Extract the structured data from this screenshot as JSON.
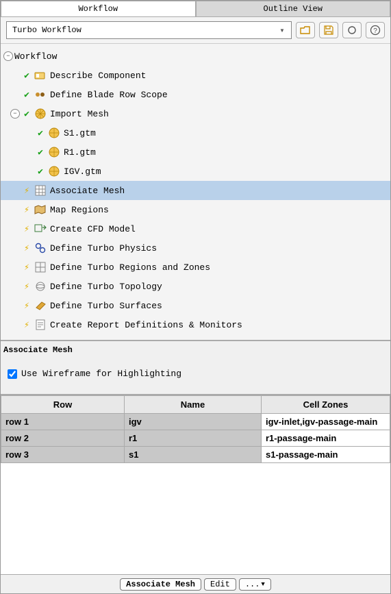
{
  "tabs": {
    "workflow": "Workflow",
    "outline": "Outline View"
  },
  "combo": {
    "value": "Turbo Workflow"
  },
  "tree": {
    "root": "Workflow",
    "items": {
      "describe": "Describe Component",
      "scope": "Define Blade Row Scope",
      "import": "Import Mesh",
      "mesh1": "S1.gtm",
      "mesh2": "R1.gtm",
      "mesh3": "IGV.gtm",
      "assoc": "Associate Mesh",
      "map": "Map Regions",
      "cfd": "Create CFD Model",
      "physics": "Define Turbo Physics",
      "regions": "Define Turbo Regions and Zones",
      "topology": "Define Turbo Topology",
      "surfaces": "Define Turbo Surfaces",
      "report": "Create Report Definitions & Monitors"
    }
  },
  "panel": {
    "title": "Associate Mesh",
    "checkbox_label": "Use Wireframe for Highlighting",
    "checkbox_checked": true
  },
  "table": {
    "headers": {
      "row": "Row",
      "name": "Name",
      "zones": "Cell Zones"
    },
    "rows": [
      {
        "row": "row 1",
        "name": "igv",
        "zones": "igv-inlet,igv-passage-main"
      },
      {
        "row": "row 2",
        "name": "r1",
        "zones": "r1-passage-main"
      },
      {
        "row": "row 3",
        "name": "s1",
        "zones": "s1-passage-main"
      }
    ]
  },
  "buttons": {
    "assoc": "Associate Mesh",
    "edit": "Edit",
    "more": "..."
  },
  "chart_data": {
    "type": "table",
    "title": "Associate Mesh",
    "headers": [
      "Row",
      "Name",
      "Cell Zones"
    ],
    "rows": [
      [
        "row 1",
        "igv",
        "igv-inlet,igv-passage-main"
      ],
      [
        "row 2",
        "r1",
        "r1-passage-main"
      ],
      [
        "row 3",
        "s1",
        "s1-passage-main"
      ]
    ]
  }
}
